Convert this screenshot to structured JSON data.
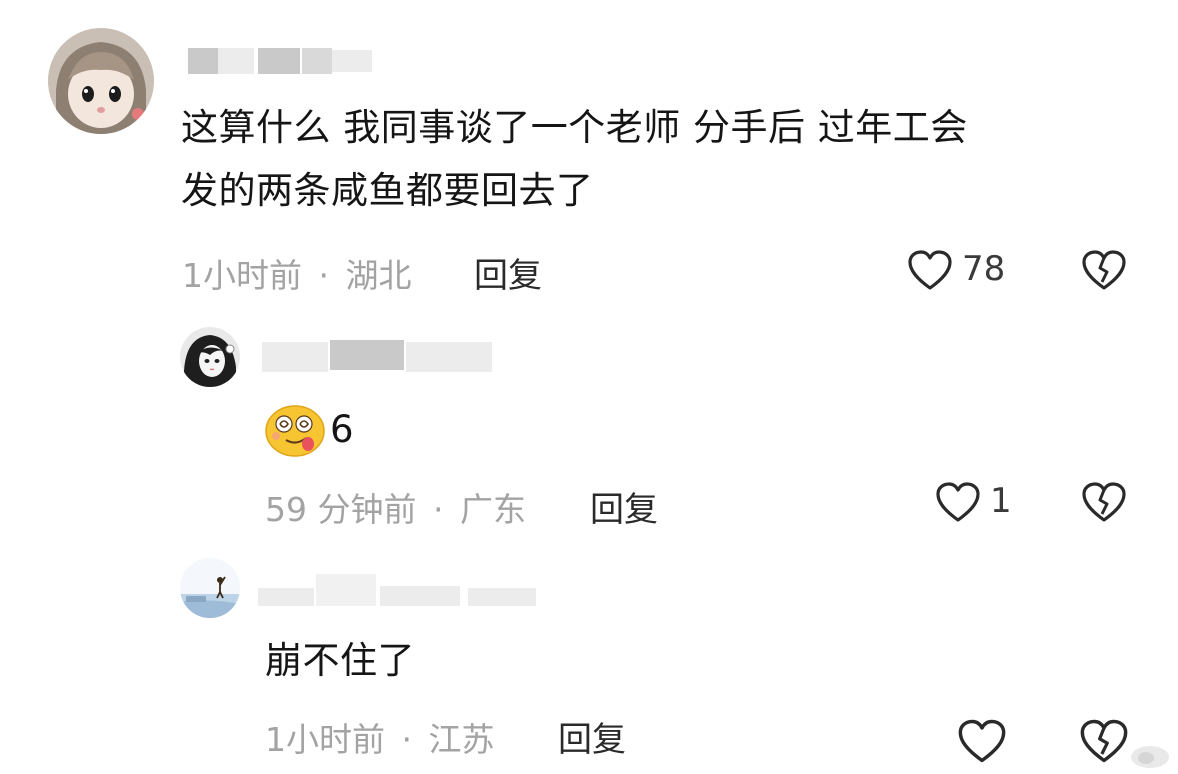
{
  "comments": [
    {
      "avatar_icon": "anime-girl-avatar-icon",
      "text_line1": "这算什么 我同事谈了一个老师 分手后 过年工会",
      "text_line2": "发的两条咸鱼都要回去了",
      "time": "1小时前",
      "separator": "·",
      "location": "湖北",
      "reply_label": "回复",
      "like_count": "78",
      "like_icon": "heart-outline-icon",
      "dislike_icon": "broken-heart-icon"
    },
    {
      "avatar_icon": "monochrome-girl-avatar-icon",
      "emoji_icon": "dizzy-tongue-face-emoji-icon",
      "text": "6",
      "time": "59 分钟前",
      "separator": "·",
      "location": "广东",
      "reply_label": "回复",
      "like_count": "1",
      "like_icon": "heart-outline-icon",
      "dislike_icon": "broken-heart-icon"
    },
    {
      "avatar_icon": "beach-person-avatar-icon",
      "text": "崩不住了",
      "time": "1小时前",
      "separator": "·",
      "location": "江苏",
      "reply_label": "回复",
      "like_icon": "heart-outline-icon",
      "dislike_icon": "broken-heart-icon"
    }
  ],
  "colors": {
    "text": "#151515",
    "meta": "#a3a3a3",
    "icon": "#2a2a2a",
    "background": "#ffffff"
  }
}
